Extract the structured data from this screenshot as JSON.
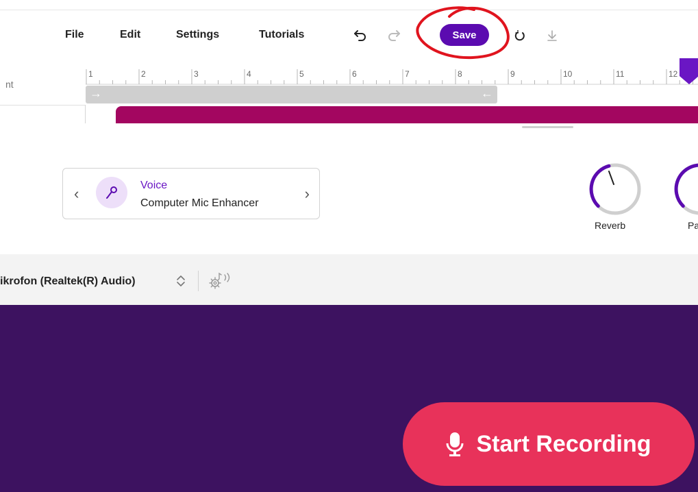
{
  "menu": {
    "file": "File",
    "edit": "Edit",
    "settings": "Settings",
    "tutorials": "Tutorials"
  },
  "toolbar": {
    "save_label": "Save",
    "icons": [
      "undo-icon",
      "redo-icon",
      "loop-icon",
      "download-icon"
    ]
  },
  "timeline": {
    "track_label": "nt",
    "ruler_numbers": [
      "1",
      "2",
      "3",
      "4",
      "5",
      "6",
      "7",
      "8",
      "9",
      "10",
      "11",
      "12"
    ]
  },
  "preset": {
    "category": "Voice",
    "name": "Computer Mic Enhancer"
  },
  "knobs": {
    "reverb_label": "Reverb",
    "second_label": "Pa"
  },
  "device": {
    "input_name": "ikrofon (Realtek(R) Audio)"
  },
  "record": {
    "label": "Start Recording"
  },
  "colors": {
    "accent": "#5b0bb0",
    "clip": "#a30660",
    "record_bg": "#3d1260",
    "record_button": "#e8325a",
    "annotation": "#e0141e"
  }
}
